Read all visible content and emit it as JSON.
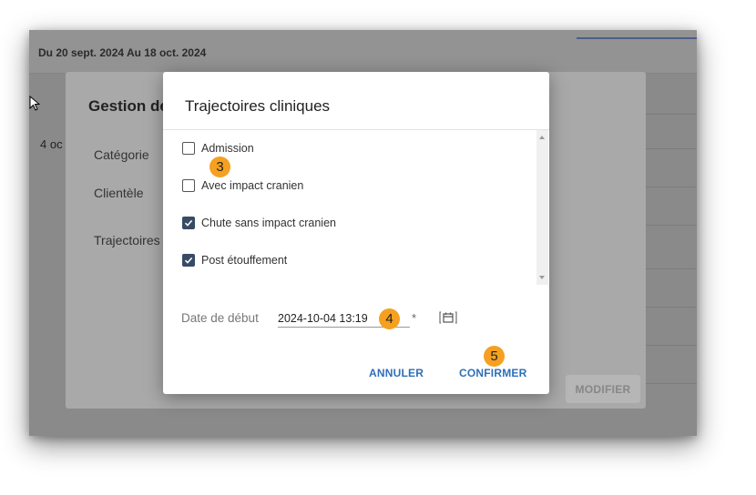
{
  "background": {
    "header_range": "Du 20 sept. 2024 Au 18 oct. 2024",
    "date_fragment": "4 oc",
    "footer_fragment": "",
    "dialog_title": "Gestion de",
    "fields": [
      "Catégorie",
      "Clientèle",
      "Trajectoires"
    ],
    "modify_button": "MODIFIER"
  },
  "dialog": {
    "title": "Trajectoires cliniques",
    "options": [
      {
        "label": "Admission",
        "checked": false
      },
      {
        "label": "Avec impact cranien",
        "checked": false
      },
      {
        "label": "Chute sans impact cranien",
        "checked": true
      },
      {
        "label": "Post étouffement",
        "checked": true
      }
    ],
    "date_label": "Date de début",
    "date_value": "2024-10-04 13:19",
    "required_mark": "*",
    "cancel_label": "ANNULER",
    "confirm_label": "CONFIRMER"
  },
  "callouts": [
    "3",
    "4",
    "5"
  ],
  "colors": {
    "callout": "#f5a020",
    "button_text": "#2f6fb8",
    "checkbox_checked": "#374b66",
    "overlay": "#8a8a8a"
  },
  "icons": [
    "cursor-icon",
    "calendar-icon",
    "check-icon",
    "scroll-up-icon",
    "scroll-down-icon"
  ]
}
